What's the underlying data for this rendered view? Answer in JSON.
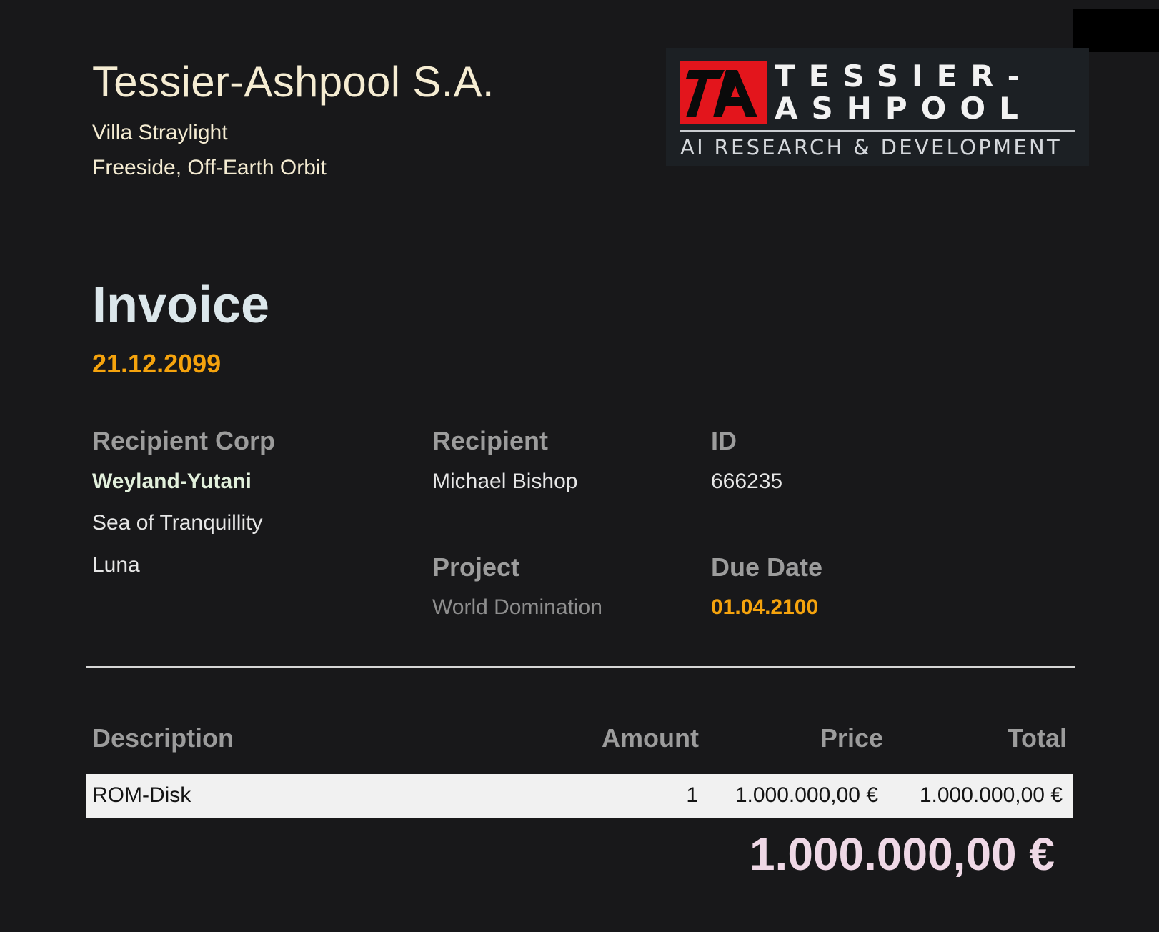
{
  "sender": {
    "company": "Tessier-Ashpool S.A.",
    "address_line1": "Villa Straylight",
    "address_line2": "Freeside, Off-Earth Orbit"
  },
  "logo": {
    "word1": "TESSIER-",
    "word2": "ASHPOOL",
    "tagline": "AI RESEARCH  & DEVELOPMENT",
    "brand_color": "#e3151c"
  },
  "invoice": {
    "title": "Invoice",
    "date": "21.12.2099"
  },
  "recipient_corp": {
    "label": "Recipient Corp",
    "name": "Weyland-Yutani",
    "line1": "Sea of Tranquillity",
    "line2": "Luna"
  },
  "recipient": {
    "label": "Recipient",
    "value": "Michael Bishop"
  },
  "id": {
    "label": "ID",
    "value": "666235"
  },
  "project": {
    "label": "Project",
    "value": "World Domination"
  },
  "due_date": {
    "label": "Due Date",
    "value": "01.04.2100"
  },
  "table": {
    "headers": {
      "description": "Description",
      "amount": "Amount",
      "price": "Price",
      "total": "Total"
    },
    "rows": [
      {
        "description": "ROM-Disk",
        "amount": "1",
        "price": "1.000.000,00 €",
        "total": "1.000.000,00 €"
      }
    ]
  },
  "grand_total": "1.000.000,00 €",
  "colors": {
    "background": "#18181a",
    "accent_orange": "#f5a30d",
    "total_pink": "#efd8e6"
  }
}
